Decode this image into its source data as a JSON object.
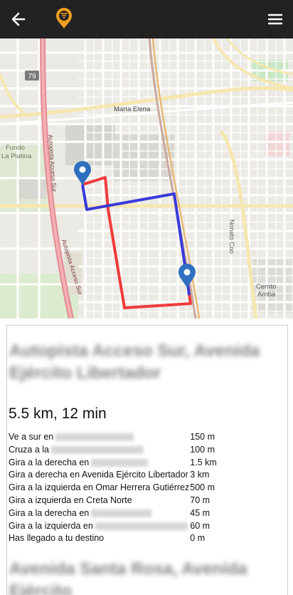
{
  "header": {
    "back_icon": "arrow-left-icon",
    "logo_icon": "brand-pin-logo",
    "menu_icon": "hamburger-menu-icon",
    "bar_color": "#222222"
  },
  "map": {
    "labels": {
      "route_79": "79",
      "maria_elena": "María Elena",
      "fundo": "Fundo",
      "la_platina": "La Platina",
      "autopista_1": "Autopista Acceso Sur",
      "autopista_2": "Autopista Acceso Sur",
      "nonato_coo": "Nonato Coo",
      "cerrito": "Cerrito",
      "arriba": "Arriba"
    },
    "route_colors": {
      "primary": "#3a3ad8",
      "alternate": "#ee3b3b"
    },
    "marker_color": "#2f6fbf"
  },
  "route": {
    "title_redacted": "Autopista Acceso Sur, Avenida Ejército Libertador",
    "summary": "5.5 km, 12 min",
    "steps": [
      {
        "instruction": "Ve a sur en",
        "distance": "150 m"
      },
      {
        "instruction": "Cruza a la",
        "distance": "100 m"
      },
      {
        "instruction": "Gira a la derecha en",
        "distance": "1.5 km"
      },
      {
        "instruction": "Gira a derecha en Avenida Ejército Libertador",
        "distance": "3 km"
      },
      {
        "instruction": "Gira a la izquierda en Omar Herrera Gutiérrez",
        "distance": "500 m"
      },
      {
        "instruction": "Gira a izquierda en Creta Norte",
        "distance": "70 m"
      },
      {
        "instruction": "Gira a la derecha en",
        "distance": "45 m"
      },
      {
        "instruction": "Gira a la izquierda en",
        "distance": "60 m"
      },
      {
        "instruction": "Has llegado a tu destino",
        "distance": "0 m"
      }
    ],
    "footer_redacted": "Avenida Santa Rosa, Avenida Ejército"
  }
}
